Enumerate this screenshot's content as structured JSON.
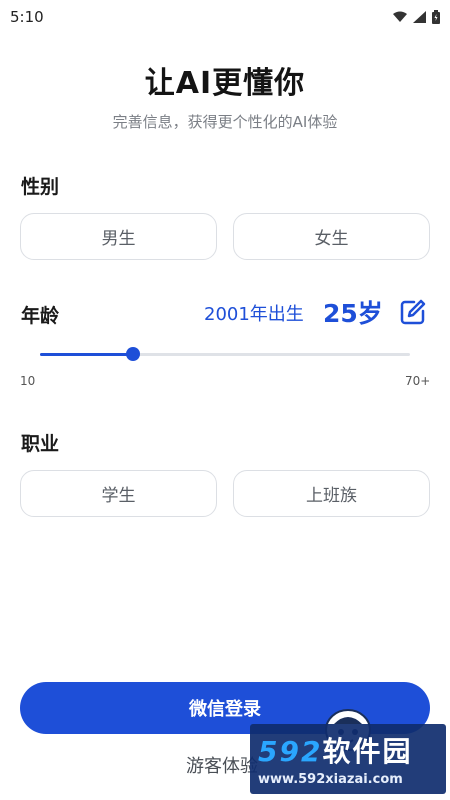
{
  "status_bar": {
    "time": "5:10"
  },
  "header": {
    "title": "让AI更懂你",
    "subtitle": "完善信息，获得更个性化的AI体验"
  },
  "gender": {
    "label": "性别",
    "options": [
      "男生",
      "女生"
    ]
  },
  "age": {
    "label": "年龄",
    "birth_year_text": "2001年出生",
    "age_text": "25岁",
    "slider": {
      "min_label": "10",
      "max_label": "70+",
      "min": 10,
      "max": 70,
      "value": 25
    }
  },
  "occupation": {
    "label": "职业",
    "options": [
      "学生",
      "上班族"
    ]
  },
  "actions": {
    "wechat_login": "微信登录",
    "guest": "游客体验"
  },
  "watermark": {
    "brand_num": "592",
    "brand_text": "软件园",
    "url": "www.592xiazai.com"
  },
  "colors": {
    "accent": "#1e4fd8",
    "border": "#dcdfe4",
    "text_muted": "#7b7f86"
  },
  "icons": {
    "edit": "edit-icon",
    "wifi": "wifi-icon",
    "signal": "signal-icon",
    "battery": "battery-icon"
  }
}
